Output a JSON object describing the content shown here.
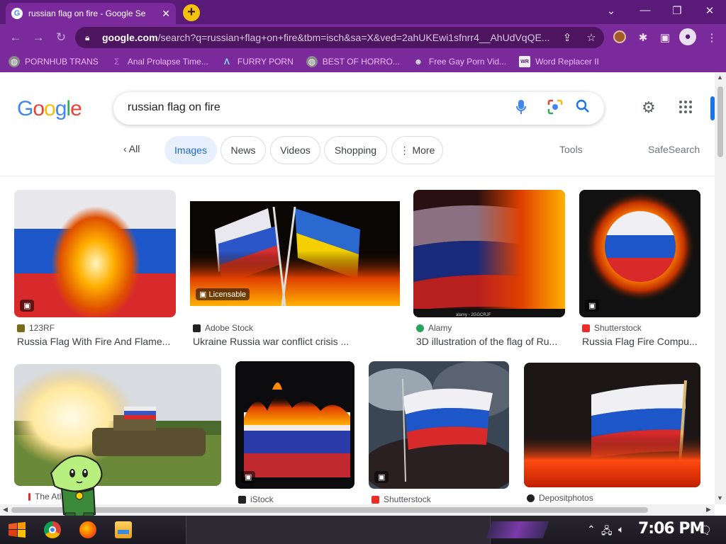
{
  "browser": {
    "tab_title": "russian flag on fire - Google Se",
    "url_host": "google.com",
    "url_path": "/search?q=russian+flag+on+fire&tbm=isch&sa=X&ved=2ahUKEwi1sfnrr4__AhUdVqQE...",
    "new_tab_label": "+",
    "minimize": "—",
    "restore": "❐",
    "close": "✕",
    "chevron": "⌄"
  },
  "bookmarks": [
    {
      "label": "PORNHUB TRANS",
      "icon": "globe-icon"
    },
    {
      "label": "Anal Prolapse Time...",
      "icon": "sigma-icon"
    },
    {
      "label": "FURRY PORN",
      "icon": "lambda-icon"
    },
    {
      "label": "BEST OF HORRO...",
      "icon": "globe-icon"
    },
    {
      "label": "Free Gay Porn Vid...",
      "icon": "mask-icon"
    },
    {
      "label": "Word Replacer II",
      "icon": "wr-icon"
    }
  ],
  "search": {
    "query": "russian flag on fire"
  },
  "filters": {
    "back": "‹  All",
    "chips": [
      "Images",
      "News",
      "Videos",
      "Shopping",
      "⋮ More"
    ],
    "tools": "Tools",
    "safesearch": "SafeSearch"
  },
  "results_row1": [
    {
      "source": "123RF",
      "title": "Russia Flag With Fire And Flame...",
      "fav_color": "#7a6a1a"
    },
    {
      "source": "Adobe Stock",
      "title": "Ukraine Russia war conflict crisis ...",
      "fav_color": "#222222",
      "badge": "Licensable"
    },
    {
      "source": "Alamy",
      "title": "3D illustration of the flag of Ru...",
      "fav_color": "#25a55f",
      "watermark": "alamy - 2GGCRJF"
    },
    {
      "source": "Shutterstock",
      "title": "Russia Flag Fire Compu...",
      "fav_color": "#ee2b24"
    }
  ],
  "results_row2": [
    {
      "source": "The Atlan",
      "fav_color": "#d9302c"
    },
    {
      "source": "iStock",
      "fav_color": "#222222"
    },
    {
      "source": "Shutterstock",
      "fav_color": "#ee2b24"
    },
    {
      "source": "Depositphotos",
      "fav_color": "#222222"
    }
  ],
  "taskbar": {
    "clock": "7:06 PM"
  },
  "colors": {
    "frame": "#7b2a9c",
    "tabstrip": "#5a1a78",
    "bookmark_text": "#f4b8ff",
    "google_blue": "#4285f4",
    "google_red": "#ea4335",
    "google_yellow": "#fbbc05",
    "google_green": "#34a853"
  }
}
